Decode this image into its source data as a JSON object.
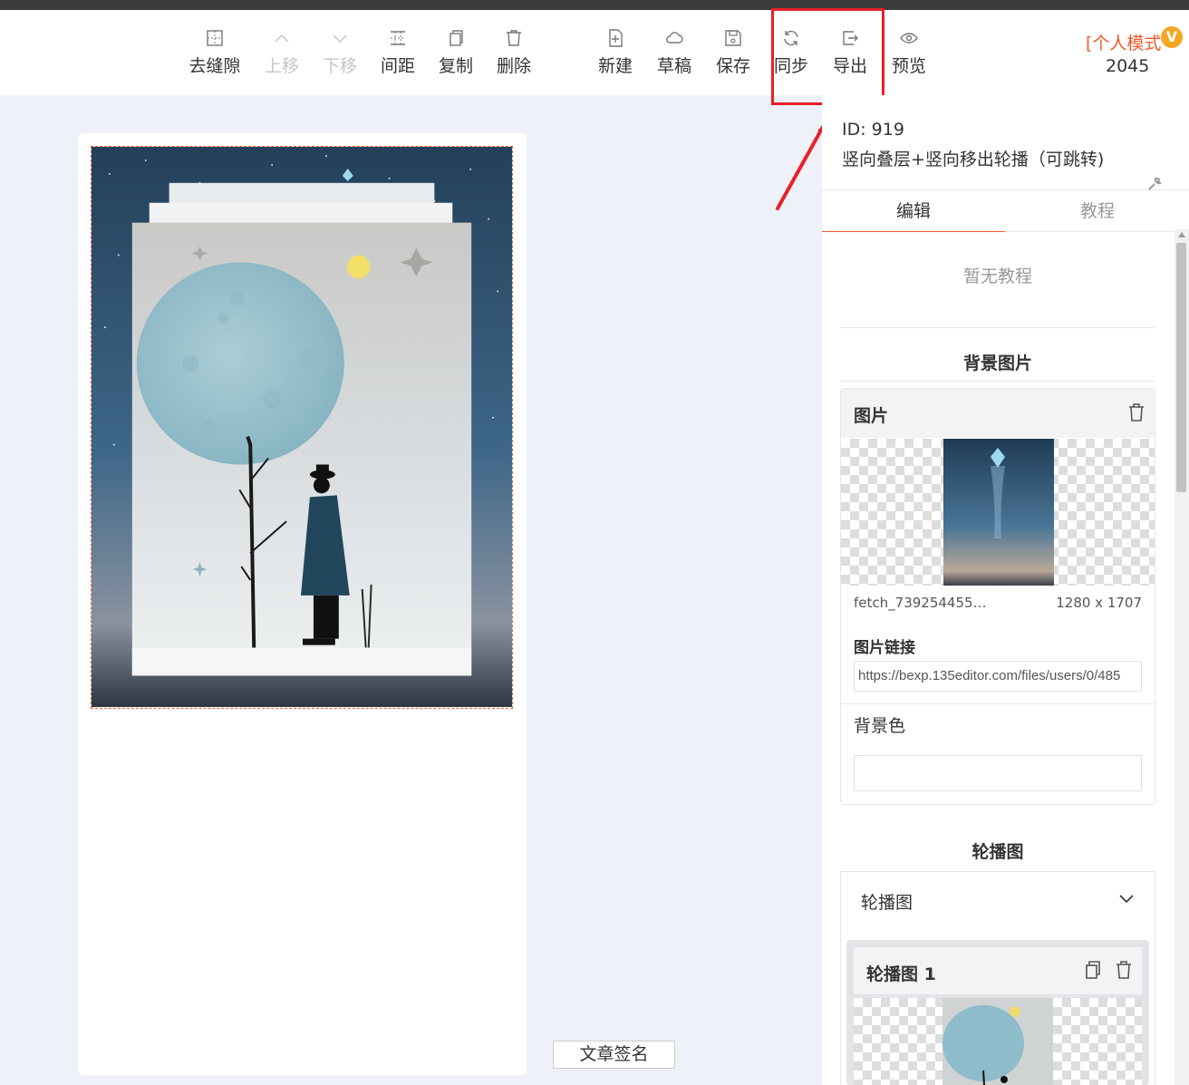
{
  "toolbar": {
    "tools": [
      {
        "key": "remove-gap",
        "label": "去缝隙",
        "icon": "grid-dashed-icon",
        "disabled": false
      },
      {
        "key": "move-up",
        "label": "上移",
        "icon": "chevron-up-icon",
        "disabled": true
      },
      {
        "key": "move-down",
        "label": "下移",
        "icon": "chevron-down-icon",
        "disabled": true
      },
      {
        "key": "spacing",
        "label": "间距",
        "icon": "spacing-grid-icon",
        "disabled": false
      },
      {
        "key": "copy",
        "label": "复制",
        "icon": "copy-icon",
        "disabled": false
      },
      {
        "key": "delete",
        "label": "删除",
        "icon": "trash-icon",
        "disabled": false
      },
      {
        "key": "new",
        "label": "新建",
        "icon": "file-plus-icon",
        "disabled": false
      },
      {
        "key": "draft",
        "label": "草稿",
        "icon": "cloud-icon",
        "disabled": false
      },
      {
        "key": "save",
        "label": "保存",
        "icon": "floppy-icon",
        "disabled": false
      },
      {
        "key": "sync",
        "label": "同步",
        "icon": "refresh-icon",
        "disabled": false
      },
      {
        "key": "export",
        "label": "导出",
        "icon": "export-icon",
        "disabled": false
      },
      {
        "key": "preview",
        "label": "预览",
        "icon": "eye-icon",
        "disabled": false
      }
    ],
    "mode_label": "[个人模式",
    "vip_badge": "V",
    "user_count": "2045"
  },
  "template": {
    "id_text": "ID: 919",
    "name": "竖向叠层+竖向移出轮播（可跳转)"
  },
  "tabs": [
    {
      "label": "编辑",
      "active": true
    },
    {
      "label": "教程",
      "active": false
    }
  ],
  "tutorial": {
    "empty_text": "暂无教程"
  },
  "background_section": {
    "title": "背景图片",
    "card_title": "图片",
    "file_name": "fetch_7392544550...",
    "file_size": "1280 x 1707",
    "link_label": "图片链接",
    "link_value": "https://bexp.135editor.com/files/users/0/485",
    "bg_color_label": "背景色",
    "bg_color_value": ""
  },
  "carousel_section": {
    "title": "轮播图",
    "group_label": "轮播图",
    "slide_title": "轮播图 1"
  },
  "canvas": {
    "signature_label": "文章签名"
  },
  "colors": {
    "accent": "#f1592a",
    "highlight": "#e8202a",
    "vip": "#f5a623"
  }
}
